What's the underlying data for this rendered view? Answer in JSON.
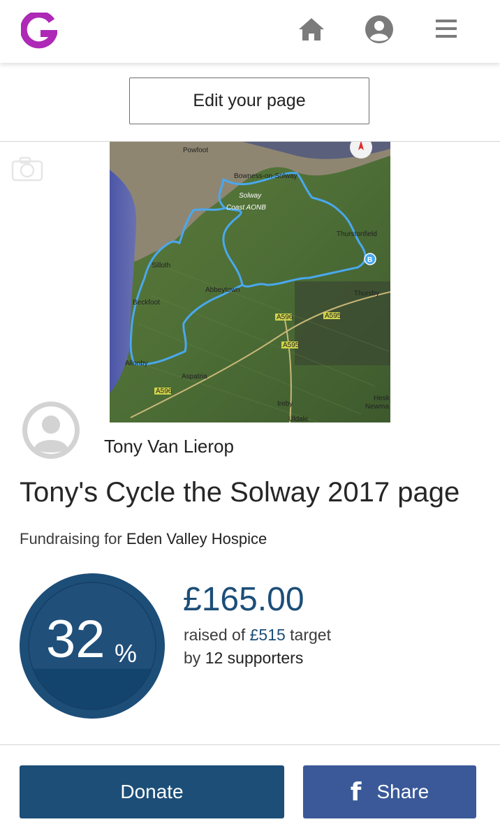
{
  "header": {
    "logo_icon": "justgiving-logo",
    "logo_letter": "G",
    "nav": [
      {
        "name": "home",
        "icon": "home-icon"
      },
      {
        "name": "account",
        "icon": "user-icon"
      },
      {
        "name": "menu",
        "icon": "hamburger-menu-icon"
      }
    ]
  },
  "edit_button": {
    "label": "Edit your page"
  },
  "cover": {
    "type": "map-image",
    "labels": [
      "Powfoot",
      "Bowness-on-Solway",
      "Solway",
      "Coast AONB",
      "Thurstonfield",
      "Silloth",
      "Abbeytown",
      "Thursby",
      "Beckfoot",
      "Allonby",
      "Aspatria",
      "Ireby",
      "Hesk",
      "Newma",
      "Uldale",
      "A596",
      "A595",
      "B"
    ]
  },
  "owner": {
    "name": "Tony Van Lierop"
  },
  "page": {
    "title": "Tony's Cycle the Solway 2017 page",
    "fundraising_prefix": "Fundraising for",
    "charity": "Eden Valley Hospice"
  },
  "progress": {
    "percent": "32",
    "percent_sign": "%",
    "percent_value": 32,
    "amount_raised": "£165.00",
    "raised_prefix": "raised of",
    "target": "£515",
    "target_suffix": "target",
    "by_prefix": "by",
    "supporters": "12 supporters"
  },
  "actions": {
    "donate_label": "Donate",
    "share_label": "Share",
    "share_icon": "facebook-icon"
  },
  "colors": {
    "brand_purple": "#ad29b6",
    "primary_blue": "#1c4e78",
    "facebook_blue": "#3b5998",
    "icon_gray": "#7b7b7b"
  }
}
